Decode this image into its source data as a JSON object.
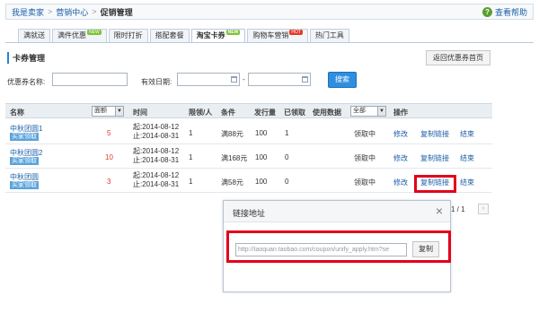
{
  "breadcrumb": {
    "items": [
      "我是卖家",
      "营销中心",
      "促销管理"
    ]
  },
  "help": {
    "label": "查看帮助"
  },
  "tabs": [
    {
      "label": "满就送",
      "badge": ""
    },
    {
      "label": "满件优惠",
      "badge": "NEW"
    },
    {
      "label": "限时打折",
      "badge": ""
    },
    {
      "label": "搭配套餐",
      "badge": ""
    },
    {
      "label": "淘宝卡券",
      "badge": "NEW",
      "active": true
    },
    {
      "label": "购物车营销",
      "badge": "HOT"
    },
    {
      "label": "热门工具",
      "badge": ""
    }
  ],
  "section": {
    "title": "卡券管理",
    "back_label": "返回优惠券首页"
  },
  "search": {
    "name_label": "优惠券名称:",
    "date_label": "有效日期:",
    "dash": "-",
    "button": "搜索"
  },
  "table": {
    "headers": {
      "name": "名称",
      "face": "面额",
      "time": "时间",
      "limit": "限领/人",
      "cond": "条件",
      "issued": "发行量",
      "claimed": "已领取",
      "usage": "使用数据",
      "status_filter": "全部",
      "ops": "操作"
    },
    "rows": [
      {
        "name": "中秋团圆1",
        "tag": "买家领取",
        "face": "5",
        "start": "起:2014-08-12",
        "end": "止:2014-08-31",
        "limit": "1",
        "cond": "满88元",
        "issued": "100",
        "claimed": "1",
        "status": "领取中",
        "edit": "修改",
        "copy": "复制链接",
        "end_op": "结束"
      },
      {
        "name": "中秋团圆2",
        "tag": "买家领取",
        "face": "10",
        "start": "起:2014-08-12",
        "end": "止:2014-08-31",
        "limit": "1",
        "cond": "满168元",
        "issued": "100",
        "claimed": "0",
        "status": "领取中",
        "edit": "修改",
        "copy": "复制链接",
        "end_op": "结束"
      },
      {
        "name": "中秋团圆",
        "tag": "买家领取",
        "face": "3",
        "start": "起:2014-08-12",
        "end": "止:2014-08-31",
        "limit": "1",
        "cond": "满58元",
        "issued": "100",
        "claimed": "0",
        "status": "领取中",
        "edit": "修改",
        "copy": "复制链接",
        "end_op": "结束"
      }
    ]
  },
  "pager": {
    "text": "1 / 1"
  },
  "dialog": {
    "title": "链接地址",
    "url": "http://taoquan.taobao.com/coupon/unify_apply.htm?se",
    "copy": "复制"
  }
}
